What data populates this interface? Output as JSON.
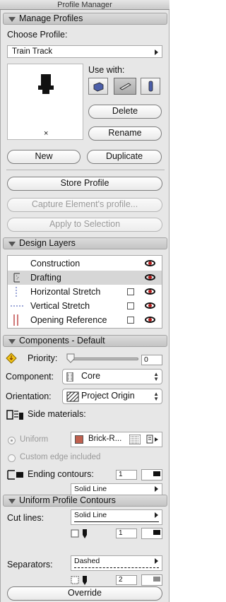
{
  "window": {
    "title": "Profile Manager"
  },
  "manage_profiles": {
    "header": "Manage Profiles",
    "choose_label": "Choose Profile:",
    "selected_profile": "Train Track",
    "preview_marker": "×",
    "use_with_label": "Use with:",
    "use_with_icons": [
      "wall-tool-icon",
      "beam-tool-icon",
      "column-tool-icon"
    ],
    "delete_label": "Delete",
    "rename_label": "Rename",
    "new_label": "New",
    "duplicate_label": "Duplicate",
    "store_label": "Store Profile",
    "capture_label": "Capture Element's profile...",
    "apply_label": "Apply to Selection"
  },
  "design_layers": {
    "header": "Design Layers",
    "rows": [
      {
        "label": "Construction",
        "selected": false,
        "has_checkbox": false
      },
      {
        "label": "Drafting",
        "selected": true,
        "has_checkbox": false
      },
      {
        "label": "Horizontal Stretch",
        "selected": false,
        "has_checkbox": true
      },
      {
        "label": "Vertical Stretch",
        "selected": false,
        "has_checkbox": true
      },
      {
        "label": "Opening Reference",
        "selected": false,
        "has_checkbox": true
      }
    ]
  },
  "components": {
    "header": "Components - Default",
    "priority_label": "Priority:",
    "priority_value": "0",
    "component_label": "Component:",
    "component_value": "Core",
    "orientation_label": "Orientation:",
    "orientation_value": "Project Origin",
    "side_materials_label": "Side materials:",
    "uniform_label": "Uniform",
    "material_name": "Brick-R...",
    "material_color": "#c0604e",
    "custom_edge_label": "Custom edge included",
    "ending_contours_label": "Ending contours:",
    "ending_pen": "1",
    "ending_line": "Solid Line"
  },
  "uniform_contours": {
    "header": "Uniform Profile Contours",
    "cut_lines_label": "Cut lines:",
    "cut_line_type": "Solid Line",
    "cut_pen": "1",
    "separators_label": "Separators:",
    "separator_line_type": "Dashed",
    "separator_pen": "2",
    "override_label": "Override"
  }
}
